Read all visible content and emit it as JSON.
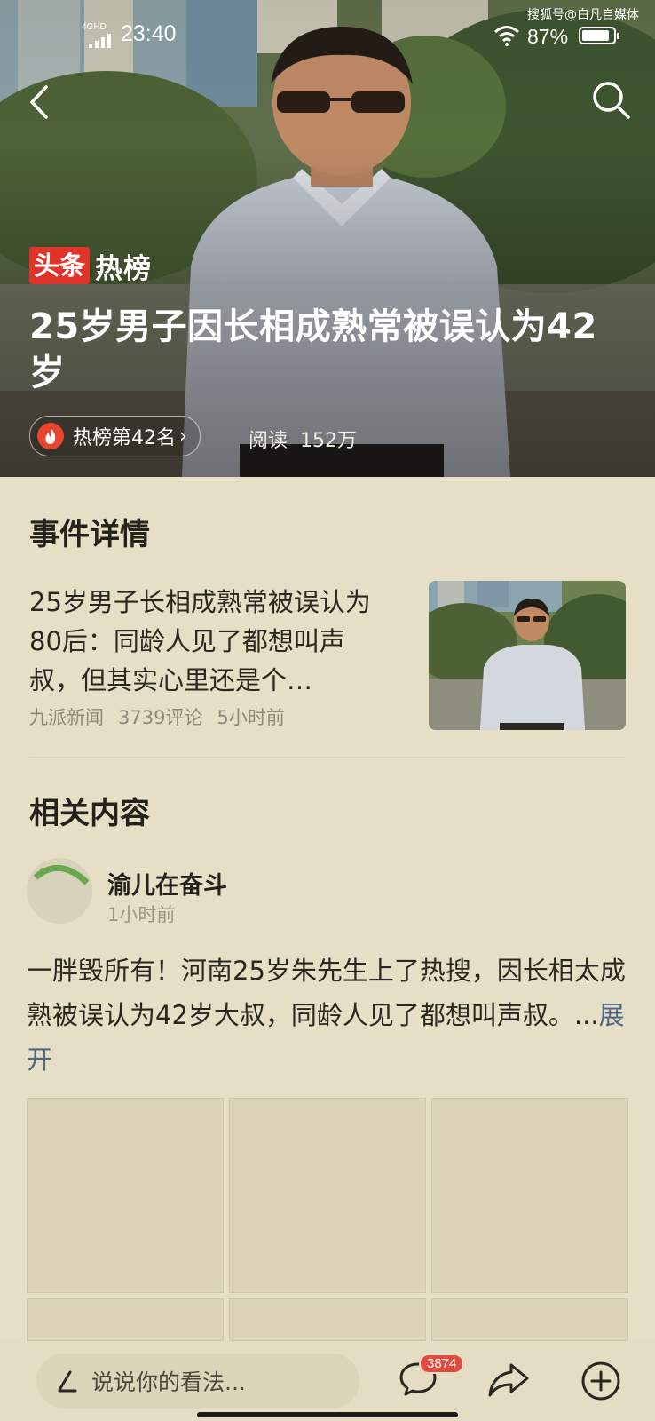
{
  "status_bar": {
    "network": "4GHD",
    "time": "23:40",
    "battery": "87%",
    "battery_level": 0.87,
    "watermark": "搜狐号@白凡自媒体"
  },
  "hero": {
    "logo_brand": "头条",
    "logo_suffix": "热榜",
    "title": "25岁男子因长相成熟常被误认为42岁",
    "rank_label": "热榜第42名",
    "rank_chevron": "›",
    "reads_label": "阅读",
    "reads_value": "152万",
    "icons": [
      "back-arrow-icon",
      "search-icon",
      "fire-icon"
    ]
  },
  "event_section": {
    "title": "事件详情",
    "article": {
      "text": "25岁男子长相成熟常被误认为80后：同龄人见了都想叫声叔，但其实心里还是个…",
      "source": "九派新闻",
      "comments": "3739评论",
      "time": "5小时前"
    }
  },
  "related_section": {
    "title": "相关内容",
    "post": {
      "author": "渝儿在奋斗",
      "time": "1小时前",
      "text": "一胖毁所有！河南25岁朱先生上了热搜，因长相太成熟被误认为42岁大叔，同龄人见了都想叫声叔。...",
      "expand": "展开"
    }
  },
  "bottom_bar": {
    "comment_placeholder": "说说你的看法...",
    "comment_count": "3874",
    "icons": [
      "pen-icon",
      "comment-icon",
      "share-icon",
      "add-circle-icon"
    ]
  },
  "colors": {
    "background": "#e6dfc6",
    "brand_red": "#e0342a",
    "link_blue": "#4d6787",
    "badge_red": "#e24a3d"
  }
}
